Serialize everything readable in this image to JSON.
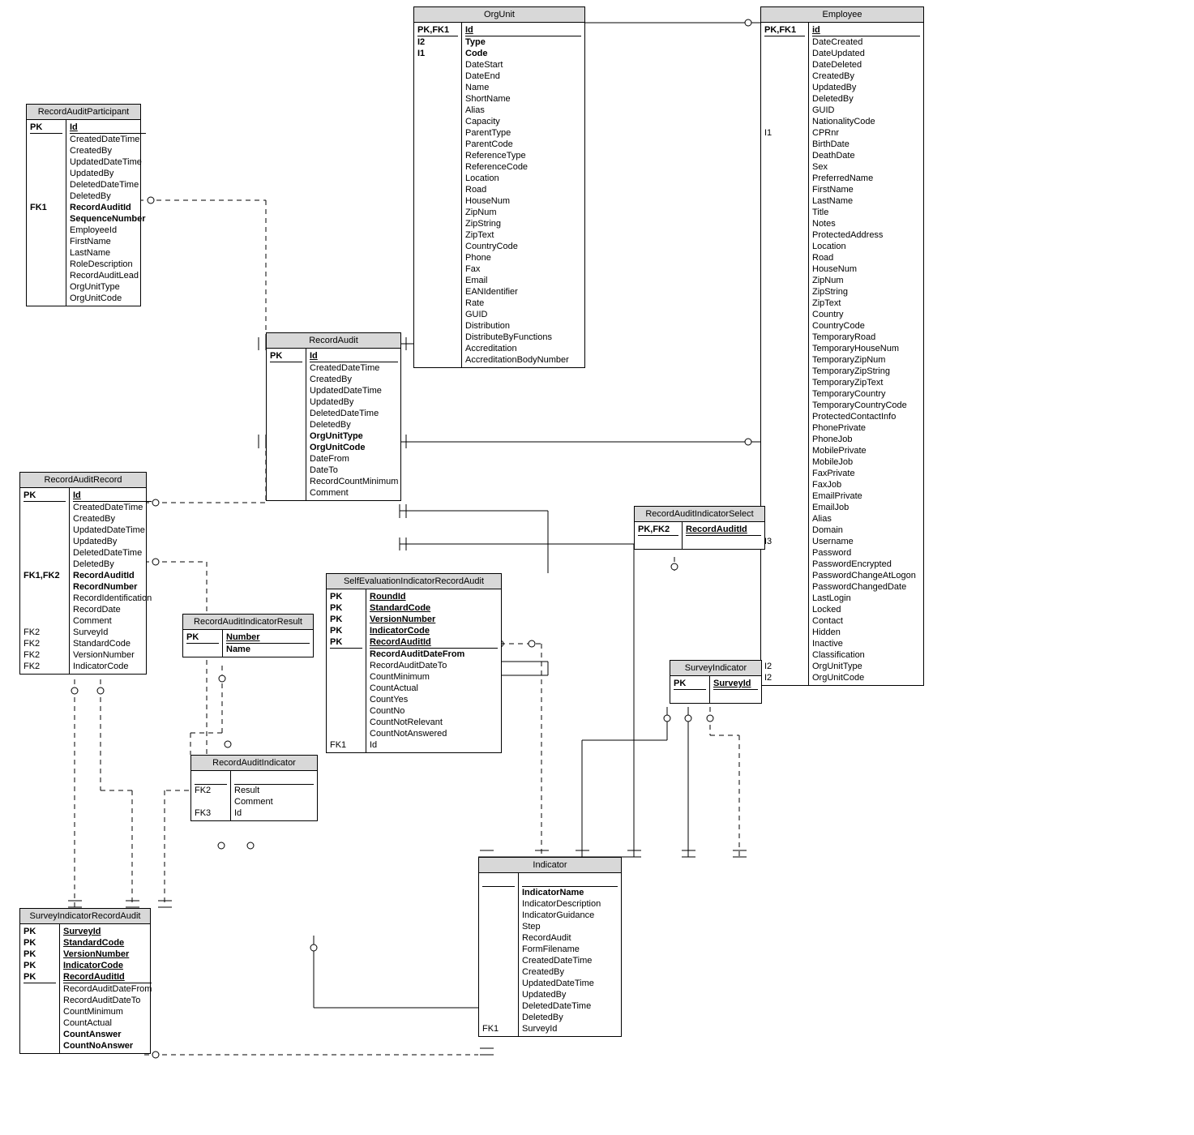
{
  "entities": {
    "RecordAuditParticipant": {
      "title": "RecordAuditParticipant",
      "pk": [
        {
          "tag": "PK",
          "name": "Id",
          "underline": true
        }
      ],
      "attrs": [
        {
          "tag": "",
          "name": "CreatedDateTime"
        },
        {
          "tag": "",
          "name": "CreatedBy"
        },
        {
          "tag": "",
          "name": "UpdatedDateTime"
        },
        {
          "tag": "",
          "name": "UpdatedBy"
        },
        {
          "tag": "",
          "name": "DeletedDateTime"
        },
        {
          "tag": "",
          "name": "DeletedBy"
        },
        {
          "tag": "FK1",
          "name": "RecordAuditId",
          "bold": true
        },
        {
          "tag": "",
          "name": "SequenceNumber",
          "bold": true
        },
        {
          "tag": "",
          "name": "EmployeeId"
        },
        {
          "tag": "",
          "name": "FirstName"
        },
        {
          "tag": "",
          "name": "LastName"
        },
        {
          "tag": "",
          "name": "RoleDescription"
        },
        {
          "tag": "",
          "name": "RecordAuditLead"
        },
        {
          "tag": "",
          "name": "OrgUnitType"
        },
        {
          "tag": "",
          "name": "OrgUnitCode"
        }
      ]
    },
    "OrgUnit": {
      "title": "OrgUnit",
      "pk": [
        {
          "tag": "PK,FK1",
          "name": "Id",
          "underline": true
        }
      ],
      "attrs": [
        {
          "tag": "I2",
          "name": "Type",
          "bold": true
        },
        {
          "tag": "I1",
          "name": "Code",
          "bold": true
        },
        {
          "tag": "",
          "name": "DateStart"
        },
        {
          "tag": "",
          "name": "DateEnd"
        },
        {
          "tag": "",
          "name": "Name"
        },
        {
          "tag": "",
          "name": "ShortName"
        },
        {
          "tag": "",
          "name": "Alias"
        },
        {
          "tag": "",
          "name": "Capacity"
        },
        {
          "tag": "",
          "name": "ParentType"
        },
        {
          "tag": "",
          "name": "ParentCode"
        },
        {
          "tag": "",
          "name": "ReferenceType"
        },
        {
          "tag": "",
          "name": "ReferenceCode"
        },
        {
          "tag": "",
          "name": "Location"
        },
        {
          "tag": "",
          "name": "Road"
        },
        {
          "tag": "",
          "name": "HouseNum"
        },
        {
          "tag": "",
          "name": "ZipNum"
        },
        {
          "tag": "",
          "name": "ZipString"
        },
        {
          "tag": "",
          "name": "ZipText"
        },
        {
          "tag": "",
          "name": "CountryCode"
        },
        {
          "tag": "",
          "name": "Phone"
        },
        {
          "tag": "",
          "name": "Fax"
        },
        {
          "tag": "",
          "name": "Email"
        },
        {
          "tag": "",
          "name": "EANIdentifier"
        },
        {
          "tag": "",
          "name": "Rate"
        },
        {
          "tag": "",
          "name": "GUID"
        },
        {
          "tag": "",
          "name": "Distribution"
        },
        {
          "tag": "",
          "name": "DistributeByFunctions"
        },
        {
          "tag": "",
          "name": "Accreditation"
        },
        {
          "tag": "",
          "name": "AccreditationBodyNumber"
        }
      ]
    },
    "Employee": {
      "title": "Employee",
      "pk": [
        {
          "tag": "PK,FK1",
          "name": "id",
          "underline": true
        }
      ],
      "attrs": [
        {
          "tag": "",
          "name": "DateCreated"
        },
        {
          "tag": "",
          "name": "DateUpdated"
        },
        {
          "tag": "",
          "name": "DateDeleted"
        },
        {
          "tag": "",
          "name": "CreatedBy"
        },
        {
          "tag": "",
          "name": "UpdatedBy"
        },
        {
          "tag": "",
          "name": "DeletedBy"
        },
        {
          "tag": "",
          "name": "GUID"
        },
        {
          "tag": "",
          "name": "NationalityCode"
        },
        {
          "tag": "I1",
          "name": "CPRnr"
        },
        {
          "tag": "",
          "name": "BirthDate"
        },
        {
          "tag": "",
          "name": "DeathDate"
        },
        {
          "tag": "",
          "name": "Sex"
        },
        {
          "tag": "",
          "name": "PreferredName"
        },
        {
          "tag": "",
          "name": "FirstName"
        },
        {
          "tag": "",
          "name": "LastName"
        },
        {
          "tag": "",
          "name": "Title"
        },
        {
          "tag": "",
          "name": "Notes"
        },
        {
          "tag": "",
          "name": "ProtectedAddress"
        },
        {
          "tag": "",
          "name": "Location"
        },
        {
          "tag": "",
          "name": "Road"
        },
        {
          "tag": "",
          "name": "HouseNum"
        },
        {
          "tag": "",
          "name": "ZipNum"
        },
        {
          "tag": "",
          "name": "ZipString"
        },
        {
          "tag": "",
          "name": "ZipText"
        },
        {
          "tag": "",
          "name": "Country"
        },
        {
          "tag": "",
          "name": "CountryCode"
        },
        {
          "tag": "",
          "name": "TemporaryRoad"
        },
        {
          "tag": "",
          "name": "TemporaryHouseNum"
        },
        {
          "tag": "",
          "name": "TemporaryZipNum"
        },
        {
          "tag": "",
          "name": "TemporaryZipString"
        },
        {
          "tag": "",
          "name": "TemporaryZipText"
        },
        {
          "tag": "",
          "name": "TemporaryCountry"
        },
        {
          "tag": "",
          "name": "TemporaryCountryCode"
        },
        {
          "tag": "",
          "name": "ProtectedContactInfo"
        },
        {
          "tag": "",
          "name": "PhonePrivate"
        },
        {
          "tag": "",
          "name": "PhoneJob"
        },
        {
          "tag": "",
          "name": "MobilePrivate"
        },
        {
          "tag": "",
          "name": "MobileJob"
        },
        {
          "tag": "",
          "name": "FaxPrivate"
        },
        {
          "tag": "",
          "name": "FaxJob"
        },
        {
          "tag": "",
          "name": "EmailPrivate"
        },
        {
          "tag": "",
          "name": "EmailJob"
        },
        {
          "tag": "",
          "name": "Alias"
        },
        {
          "tag": "",
          "name": "Domain"
        },
        {
          "tag": "I3",
          "name": "Username"
        },
        {
          "tag": "",
          "name": "Password"
        },
        {
          "tag": "",
          "name": "PasswordEncrypted"
        },
        {
          "tag": "",
          "name": "PasswordChangeAtLogon"
        },
        {
          "tag": "",
          "name": "PasswordChangedDate"
        },
        {
          "tag": "",
          "name": "LastLogin"
        },
        {
          "tag": "",
          "name": "Locked"
        },
        {
          "tag": "",
          "name": "Contact"
        },
        {
          "tag": "",
          "name": "Hidden"
        },
        {
          "tag": "",
          "name": "Inactive"
        },
        {
          "tag": "",
          "name": "Classification"
        },
        {
          "tag": "I2",
          "name": "OrgUnitType"
        },
        {
          "tag": "I2",
          "name": "OrgUnitCode"
        }
      ]
    },
    "RecordAudit": {
      "title": "RecordAudit",
      "pk": [
        {
          "tag": "PK",
          "name": "Id",
          "underline": true
        }
      ],
      "attrs": [
        {
          "tag": "",
          "name": "CreatedDateTime"
        },
        {
          "tag": "",
          "name": "CreatedBy"
        },
        {
          "tag": "",
          "name": "UpdatedDateTime"
        },
        {
          "tag": "",
          "name": "UpdatedBy"
        },
        {
          "tag": "",
          "name": "DeletedDateTime"
        },
        {
          "tag": "",
          "name": "DeletedBy"
        },
        {
          "tag": "",
          "name": "OrgUnitType",
          "bold": true
        },
        {
          "tag": "",
          "name": "OrgUnitCode",
          "bold": true
        },
        {
          "tag": "",
          "name": "DateFrom"
        },
        {
          "tag": "",
          "name": "DateTo"
        },
        {
          "tag": "",
          "name": "RecordCountMinimum"
        },
        {
          "tag": "",
          "name": "Comment"
        }
      ]
    },
    "RecordAuditRecord": {
      "title": "RecordAuditRecord",
      "pk": [
        {
          "tag": "PK",
          "name": "Id",
          "underline": true
        }
      ],
      "attrs": [
        {
          "tag": "",
          "name": "CreatedDateTime"
        },
        {
          "tag": "",
          "name": "CreatedBy"
        },
        {
          "tag": "",
          "name": "UpdatedDateTime"
        },
        {
          "tag": "",
          "name": "UpdatedBy"
        },
        {
          "tag": "",
          "name": "DeletedDateTime"
        },
        {
          "tag": "",
          "name": "DeletedBy"
        },
        {
          "tag": "FK1,FK2",
          "name": "RecordAuditId",
          "bold": true
        },
        {
          "tag": "",
          "name": "RecordNumber",
          "bold": true
        },
        {
          "tag": "",
          "name": "RecordIdentification"
        },
        {
          "tag": "",
          "name": "RecordDate"
        },
        {
          "tag": "",
          "name": "Comment"
        },
        {
          "tag": "FK2",
          "name": "SurveyId"
        },
        {
          "tag": "FK2",
          "name": "StandardCode"
        },
        {
          "tag": "FK2",
          "name": "VersionNumber"
        },
        {
          "tag": "FK2",
          "name": "IndicatorCode"
        }
      ]
    },
    "RecordAuditIndicatorResult": {
      "title": "RecordAuditIndicatorResult",
      "pk": [
        {
          "tag": "PK",
          "name": "Number",
          "underline": true
        }
      ],
      "attrs": [
        {
          "tag": "",
          "name": "Name",
          "bold": true
        }
      ]
    },
    "SelfEvaluationIndicatorRecordAudit": {
      "title": "SelfEvaluationIndicatorRecordAudit",
      "pk": [
        {
          "tag": "PK",
          "name": "RoundId",
          "underline": true
        },
        {
          "tag": "PK",
          "name": "StandardCode",
          "underline": true
        },
        {
          "tag": "PK",
          "name": "VersionNumber",
          "underline": true
        },
        {
          "tag": "PK",
          "name": "IndicatorCode",
          "underline": true
        },
        {
          "tag": "PK",
          "name": "RecordAuditId",
          "underline": true
        }
      ],
      "attrs": [
        {
          "tag": "",
          "name": "RecordAuditDateFrom",
          "bold": true
        },
        {
          "tag": "",
          "name": "RecordAuditDateTo"
        },
        {
          "tag": "",
          "name": "CountMinimum"
        },
        {
          "tag": "",
          "name": "CountActual"
        },
        {
          "tag": "",
          "name": "CountYes"
        },
        {
          "tag": "",
          "name": "CountNo"
        },
        {
          "tag": "",
          "name": "CountNotRelevant"
        },
        {
          "tag": "",
          "name": "CountNotAnswered"
        },
        {
          "tag": "FK1",
          "name": "Id"
        }
      ]
    },
    "RecordAuditIndicatorSelect": {
      "title": "RecordAuditIndicatorSelect",
      "pk": [
        {
          "tag": "PK,FK2",
          "name": "RecordAuditId",
          "underline": true
        }
      ],
      "attrs": []
    },
    "SurveyIndicator": {
      "title": "SurveyIndicator",
      "pk": [
        {
          "tag": "PK",
          "name": "SurveyId",
          "underline": true
        }
      ],
      "attrs": []
    },
    "RecordAuditIndicator": {
      "title": "RecordAuditIndicator",
      "pk": [],
      "attrs": [
        {
          "tag": "FK2",
          "name": "Result"
        },
        {
          "tag": "",
          "name": "Comment"
        },
        {
          "tag": "FK3",
          "name": "Id"
        }
      ]
    },
    "Indicator": {
      "title": "Indicator",
      "pk": [],
      "attrs": [
        {
          "tag": "",
          "name": "IndicatorName",
          "bold": true
        },
        {
          "tag": "",
          "name": "IndicatorDescription"
        },
        {
          "tag": "",
          "name": "IndicatorGuidance"
        },
        {
          "tag": "",
          "name": "Step"
        },
        {
          "tag": "",
          "name": "RecordAudit"
        },
        {
          "tag": "",
          "name": "FormFilename"
        },
        {
          "tag": "",
          "name": "CreatedDateTime"
        },
        {
          "tag": "",
          "name": "CreatedBy"
        },
        {
          "tag": "",
          "name": "UpdatedDateTime"
        },
        {
          "tag": "",
          "name": "UpdatedBy"
        },
        {
          "tag": "",
          "name": "DeletedDateTime"
        },
        {
          "tag": "",
          "name": "DeletedBy"
        },
        {
          "tag": "FK1",
          "name": "SurveyId"
        }
      ]
    },
    "SurveyIndicatorRecordAudit": {
      "title": "SurveyIndicatorRecordAudit",
      "pk": [
        {
          "tag": "PK",
          "name": "SurveyId",
          "underline": true
        },
        {
          "tag": "PK",
          "name": "StandardCode",
          "underline": true
        },
        {
          "tag": "PK",
          "name": "VersionNumber",
          "underline": true
        },
        {
          "tag": "PK",
          "name": "IndicatorCode",
          "underline": true
        },
        {
          "tag": "PK",
          "name": "RecordAuditId",
          "underline": true
        }
      ],
      "attrs": [
        {
          "tag": "",
          "name": "RecordAuditDateFrom"
        },
        {
          "tag": "",
          "name": "RecordAuditDateTo"
        },
        {
          "tag": "",
          "name": "CountMinimum"
        },
        {
          "tag": "",
          "name": "CountActual"
        },
        {
          "tag": "",
          "name": "CountAnswer",
          "bold": true
        },
        {
          "tag": "",
          "name": "CountNoAnswer",
          "bold": true
        }
      ]
    }
  }
}
